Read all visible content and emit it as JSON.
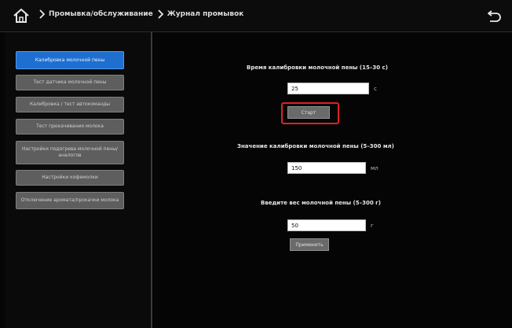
{
  "breadcrumb": {
    "item1": "Промывка/обслуживание",
    "item2": "Журнал промывок"
  },
  "sidebar": {
    "items": [
      {
        "label": "Калибровка молочной пены"
      },
      {
        "label": "Тест датчика молочной пены"
      },
      {
        "label": "Калибровка / тест автокоманды"
      },
      {
        "label": "Тест прокачивания молока"
      },
      {
        "label": "Настройки подогрева молочной пены/аналогов"
      },
      {
        "label": "Настройки кофемолки"
      },
      {
        "label": "Отключение аромата/прокачки молока"
      }
    ]
  },
  "main": {
    "time_label": "Время калибровки молочной пены (15–30 с)",
    "time_value": "25",
    "time_unit": "с",
    "start_button": "Старт",
    "value_label": "Значение калибровки молочной пены (5–300 мл)",
    "value_value": "150",
    "value_unit": "мл",
    "weight_label": "Введите вес молочной пены (5–300 г)",
    "weight_value": "50",
    "weight_unit": "г",
    "confirm_button": "Применить"
  },
  "colors": {
    "active_tab": "#1e6fd0",
    "highlight": "#e0202a"
  }
}
